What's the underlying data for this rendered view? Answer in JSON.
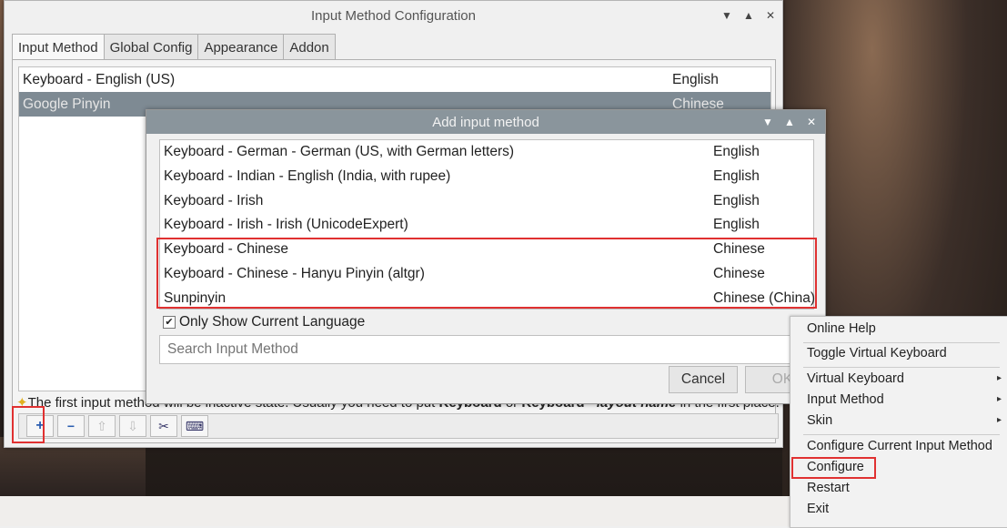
{
  "window": {
    "title": "Input Method Configuration",
    "tabs": [
      "Input Method",
      "Global Config",
      "Appearance",
      "Addon"
    ],
    "input_methods": [
      {
        "name": "Keyboard - English (US)",
        "lang": "English"
      },
      {
        "name": "Google Pinyin",
        "lang": "Chinese (China)"
      }
    ],
    "hint_prefix": "The first input method will be inactive state. Usually you need to put ",
    "hint_bold1": "Keyboard",
    "hint_mid": " or ",
    "hint_bold2": "Keyboard - ",
    "hint_italic": "layout name",
    "hint_suffix": " in the first place.",
    "toolbar": {
      "add": "+",
      "remove": "−",
      "up": "⇧",
      "down": "⇩",
      "configure": "✂",
      "keyboard": "⌨"
    }
  },
  "dialog": {
    "title": "Add input method",
    "items": [
      {
        "name": "Keyboard - German - German (US, with German letters)",
        "lang": "English"
      },
      {
        "name": "Keyboard - Indian - English (India, with rupee)",
        "lang": "English"
      },
      {
        "name": "Keyboard - Irish",
        "lang": "English"
      },
      {
        "name": "Keyboard - Irish - Irish (UnicodeExpert)",
        "lang": "English"
      },
      {
        "name": "Keyboard - Chinese",
        "lang": "Chinese"
      },
      {
        "name": "Keyboard - Chinese - Hanyu Pinyin (altgr)",
        "lang": "Chinese"
      },
      {
        "name": "Sunpinyin",
        "lang": "Chinese (China)"
      }
    ],
    "checkbox_label": "Only Show Current Language",
    "search_placeholder": "Search Input Method",
    "cancel": "Cancel",
    "ok": "OK"
  },
  "menu": {
    "items": [
      "Online Help",
      "Toggle Virtual Keyboard",
      "Virtual Keyboard",
      "Input Method",
      "Skin",
      "Configure Current Input Method",
      "Configure",
      "Restart",
      "Exit"
    ]
  },
  "colors": {
    "highlight": "#e03131",
    "selection": "#7e8a93",
    "dialog_title": "#8a959c"
  }
}
